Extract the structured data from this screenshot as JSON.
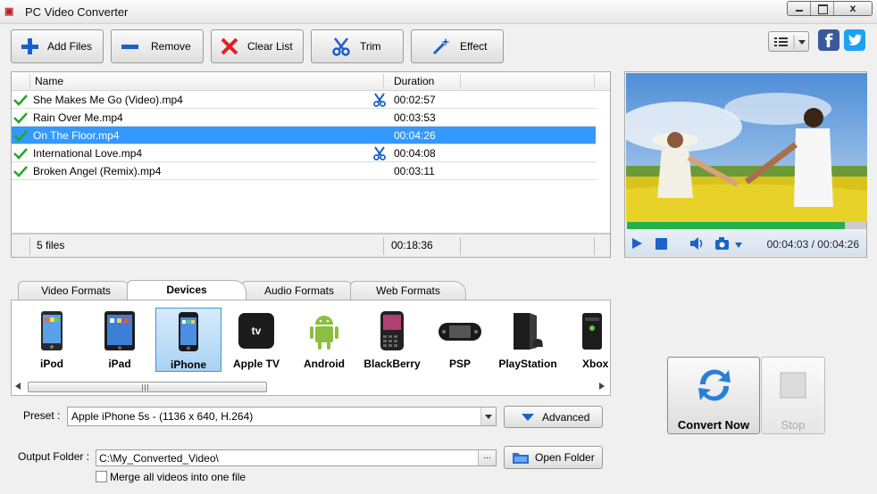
{
  "window": {
    "title": "PC Video Converter",
    "close_glyph": "x"
  },
  "toolbar": {
    "add_files": "Add Files",
    "remove": "Remove",
    "clear_list": "Clear List",
    "trim": "Trim",
    "effect": "Effect"
  },
  "social": {
    "facebook": "f",
    "twitter_icon": "twitter-icon"
  },
  "file_list": {
    "columns": {
      "name": "Name",
      "duration": "Duration"
    },
    "rows": [
      {
        "name": "She Makes Me Go (Video).mp4",
        "duration": "00:02:57",
        "trimmed": true,
        "selected": false
      },
      {
        "name": "Rain Over Me.mp4",
        "duration": "00:03:53",
        "trimmed": false,
        "selected": false
      },
      {
        "name": "On The Floor.mp4",
        "duration": "00:04:26",
        "trimmed": false,
        "selected": true
      },
      {
        "name": "International Love.mp4",
        "duration": "00:04:08",
        "trimmed": true,
        "selected": false
      },
      {
        "name": "Broken Angel (Remix).mp4",
        "duration": "00:03:11",
        "trimmed": false,
        "selected": false
      }
    ],
    "footer": {
      "count": "5 files",
      "total": "00:18:36"
    }
  },
  "player": {
    "time": "00:04:03 / 00:04:26",
    "progress": 0.91
  },
  "format_tabs": [
    "Video Formats",
    "Devices",
    "Audio Formats",
    "Web Formats"
  ],
  "active_tab": "Devices",
  "devices": [
    {
      "label": "iPod",
      "icon": "ipod-icon"
    },
    {
      "label": "iPad",
      "icon": "ipad-icon"
    },
    {
      "label": "iPhone",
      "icon": "iphone-icon",
      "selected": true
    },
    {
      "label": "Apple TV",
      "icon": "appletv-icon"
    },
    {
      "label": "Android",
      "icon": "android-icon"
    },
    {
      "label": "BlackBerry",
      "icon": "blackberry-icon"
    },
    {
      "label": "PSP",
      "icon": "psp-icon"
    },
    {
      "label": "PlayStation",
      "icon": "playstation-icon"
    },
    {
      "label": "Xbox",
      "icon": "xbox-icon"
    }
  ],
  "appletv_mark": "tv",
  "preset": {
    "label": "Preset :",
    "value": "Apple iPhone 5s - (1136 x 640, H.264)",
    "advanced": "Advanced"
  },
  "output": {
    "label": "Output Folder :",
    "path": "C:\\My_Converted_Video\\",
    "browse": "...",
    "open_folder": "Open Folder",
    "merge_label": "Merge all videos into one file",
    "merge_checked": false
  },
  "actions": {
    "convert_now": "Convert Now",
    "stop": "Stop"
  },
  "colors": {
    "selection": "#3399ff",
    "progress": "#22b14c",
    "facebook": "#3b5998",
    "twitter": "#1da1f2"
  }
}
